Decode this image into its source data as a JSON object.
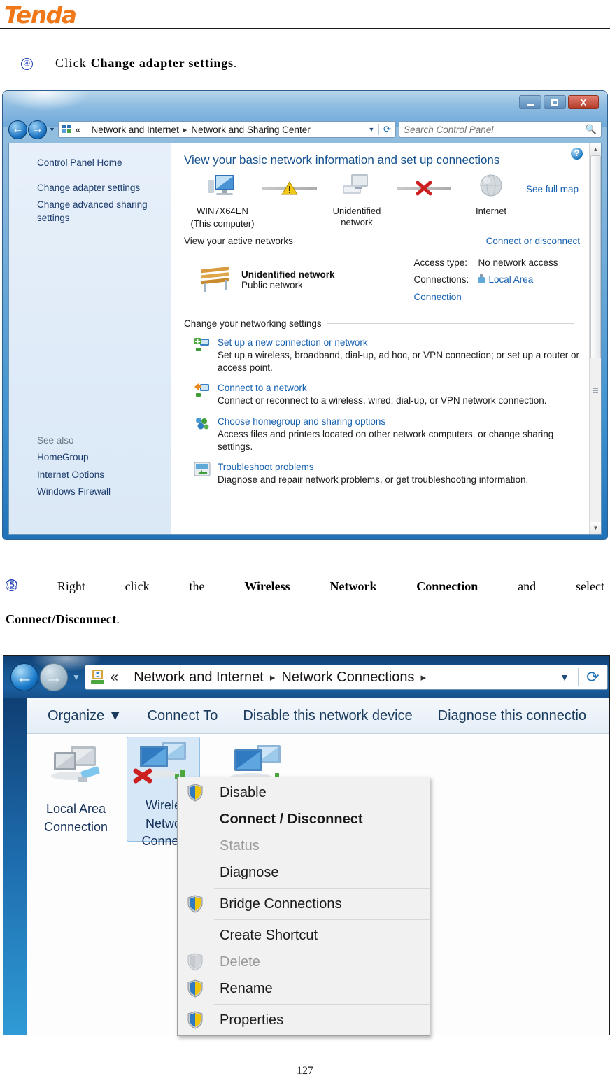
{
  "brand": {
    "name": "Tenda"
  },
  "steps": {
    "step4": {
      "num": "④",
      "prefix": "Click ",
      "bold": "Change adapter settings",
      "suffix": "."
    },
    "step5": {
      "num": "⑤",
      "words": [
        "Right",
        "click",
        "the",
        "Wireless",
        "Network",
        "Connection",
        "and",
        "select"
      ],
      "line2_bold": "Connect/Disconnect",
      "line2_suffix": "."
    }
  },
  "window1": {
    "title_buttons": {
      "minimize": "minimize-icon",
      "maximize": "maximize-icon",
      "close": "X"
    },
    "address": {
      "chevrons": "«",
      "crumb1": "Network and Internet",
      "crumb2": "Network and Sharing Center",
      "dropdown": "▼",
      "refresh": "refresh-icon"
    },
    "search": {
      "placeholder": "Search Control Panel",
      "icon": "search-icon"
    },
    "sidebar": {
      "home": "Control Panel Home",
      "links": [
        "Change adapter settings",
        "Change advanced sharing settings"
      ],
      "see_also_label": "See also",
      "see_also": [
        "HomeGroup",
        "Internet Options",
        "Windows Firewall"
      ]
    },
    "main": {
      "heading": "View your basic network information and set up connections",
      "help_icon": "?",
      "see_full_map": "See full map",
      "map": {
        "computer_name": "WIN7X64EN",
        "computer_sub": "(This computer)",
        "network_label": "Unidentified network",
        "internet_label": "Internet"
      },
      "active_networks_label": "View your active networks",
      "connect_or_disconnect": "Connect or disconnect",
      "active_network": {
        "name": "Unidentified network",
        "type": "Public network",
        "access_type_key": "Access type:",
        "access_type_val": "No network access",
        "connections_key": "Connections:",
        "connections_val": "Local Area Connection"
      },
      "change_settings_label": "Change your networking settings",
      "tasks": [
        {
          "title": "Set up a new connection or network",
          "desc": "Set up a wireless, broadband, dial-up, ad hoc, or VPN connection; or set up a router or access point."
        },
        {
          "title": "Connect to a network",
          "desc": "Connect or reconnect to a wireless, wired, dial-up, or VPN network connection."
        },
        {
          "title": "Choose homegroup and sharing options",
          "desc": "Access files and printers located on other network computers, or change sharing settings."
        },
        {
          "title": "Troubleshoot problems",
          "desc": "Diagnose and repair network problems, or get troubleshooting information."
        }
      ]
    }
  },
  "window2": {
    "address": {
      "chevrons": "«",
      "crumb1": "Network and Internet",
      "crumb2": "Network Connections",
      "dropdown": "▼",
      "refresh": "refresh-icon"
    },
    "toolbar": [
      "Organize ▼",
      "Connect To",
      "Disable this network device",
      "Diagnose this connectio"
    ],
    "connections": [
      {
        "name_l1": "Local Area",
        "name_l2": "Connection",
        "name_l3": "",
        "selected": false
      },
      {
        "name_l1": "Wirele",
        "name_l2": "Netwo",
        "name_l3": "Connec",
        "selected": true
      },
      {
        "name_l1": "",
        "name_l2": "",
        "name_l3": "",
        "selected": false
      }
    ],
    "context_menu": [
      {
        "label": "Disable",
        "shield": true,
        "disabled": false,
        "bold": false
      },
      {
        "label": "Connect / Disconnect",
        "shield": false,
        "disabled": false,
        "bold": true
      },
      {
        "label": "Status",
        "shield": false,
        "disabled": true,
        "bold": false
      },
      {
        "label": "Diagnose",
        "shield": false,
        "disabled": false,
        "bold": false
      },
      {
        "sep": true
      },
      {
        "label": "Bridge Connections",
        "shield": true,
        "disabled": false,
        "bold": false
      },
      {
        "sep": true
      },
      {
        "label": "Create Shortcut",
        "shield": false,
        "disabled": false,
        "bold": false
      },
      {
        "label": "Delete",
        "shield": true,
        "disabled": true,
        "bold": false
      },
      {
        "label": "Rename",
        "shield": true,
        "disabled": false,
        "bold": false
      },
      {
        "sep": true
      },
      {
        "label": "Properties",
        "shield": true,
        "disabled": false,
        "bold": false
      }
    ]
  },
  "footer": {
    "page_number": "127"
  },
  "colors": {
    "brand_orange": "#f07818",
    "link_blue": "#1560b0",
    "title_blue": "#14508f"
  }
}
